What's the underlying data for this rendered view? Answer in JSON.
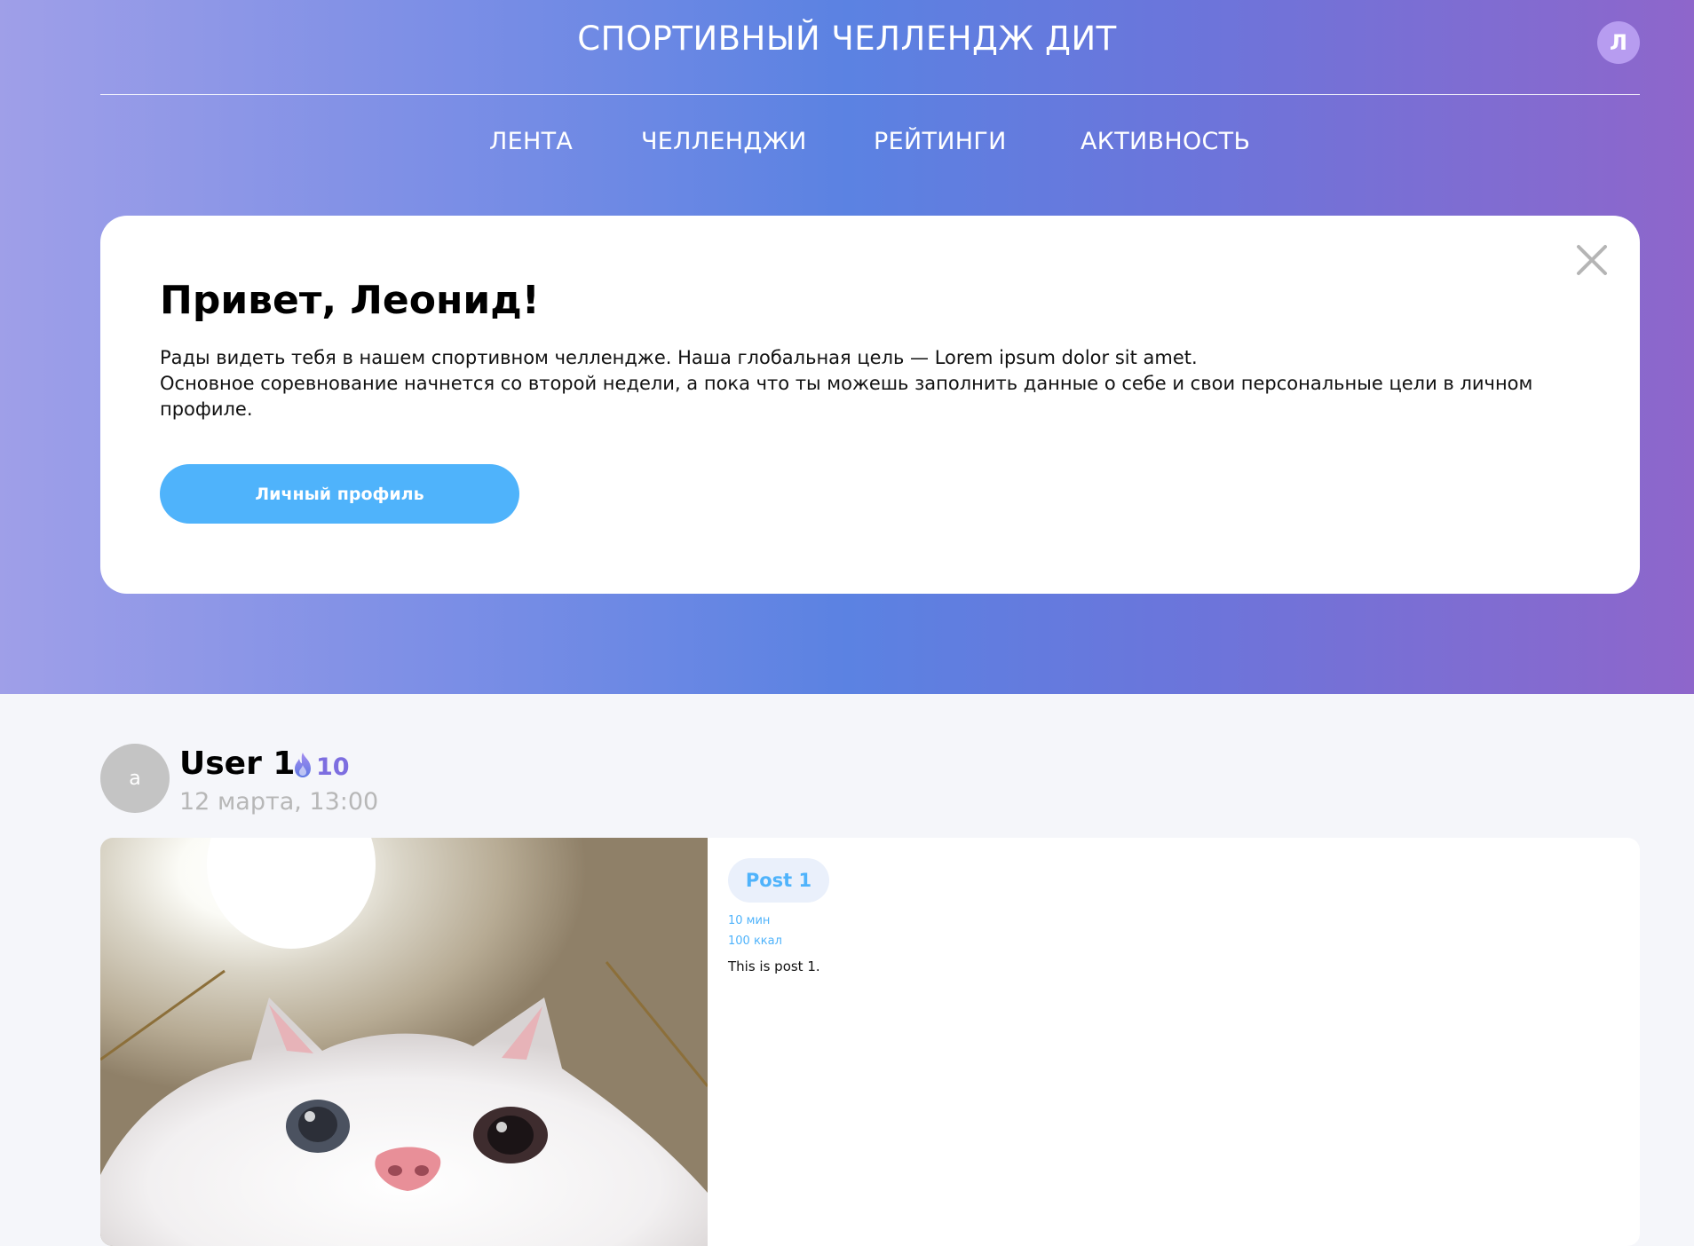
{
  "header": {
    "site_title": "СПОРТИВНЫЙ ЧЕЛЛЕНДЖ ДИТ",
    "user_initial": "Л"
  },
  "nav": {
    "items": [
      {
        "label": "ЛЕНТА"
      },
      {
        "label": "ЧЕЛЛЕНДЖИ"
      },
      {
        "label": "РЕЙТИНГИ"
      },
      {
        "label": "АКТИВНОСТЬ"
      }
    ]
  },
  "welcome": {
    "title": "Привет, Леонид!",
    "line1": "Рады видеть тебя в нашем спортивном челлендже. Наша глобальная цель — Lorem ipsum dolor sit amet.",
    "line2": "Основное соревнование начнется со второй недели, а пока что ты можешь заполнить данные о себе и свои персональные цели в личном профиле.",
    "button_label": "Личный профиль"
  },
  "post": {
    "avatar_initial": "a",
    "user_name": "User 1",
    "streak": "10",
    "date": "12 марта, 13:00",
    "tag": "Post 1",
    "duration": "10 мин",
    "calories": "100 ккал",
    "text": "This is post 1."
  },
  "colors": {
    "accent_blue": "#4fb3fb",
    "streak_purple": "#7d6ee0",
    "page_bg": "#f5f6fa"
  }
}
